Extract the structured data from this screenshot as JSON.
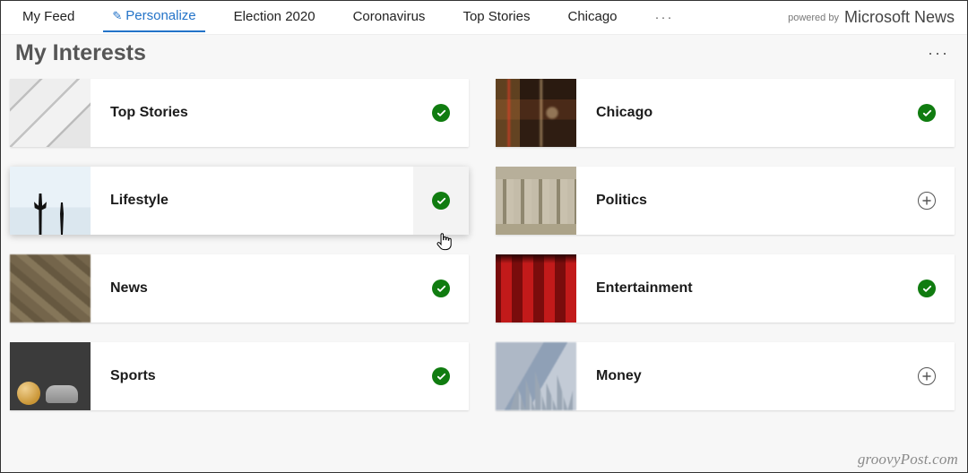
{
  "topnav": {
    "tabs": [
      {
        "label": "My Feed"
      },
      {
        "label": "Personalize",
        "active": true,
        "icon": "pencil"
      },
      {
        "label": "Election 2020"
      },
      {
        "label": "Coronavirus"
      },
      {
        "label": "Top Stories"
      },
      {
        "label": "Chicago"
      }
    ],
    "more": "···",
    "powered_by": "powered by",
    "brand": "Microsoft News"
  },
  "heading": {
    "title": "My Interests",
    "more": "···"
  },
  "cards": [
    {
      "title": "Top Stories",
      "selected": true,
      "thumb": "th-newspaper"
    },
    {
      "title": "Chicago",
      "selected": true,
      "thumb": "th-chicago"
    },
    {
      "title": "Lifestyle",
      "selected": true,
      "thumb": "th-lifestyle",
      "hover": true
    },
    {
      "title": "Politics",
      "selected": false,
      "thumb": "th-politics"
    },
    {
      "title": "News",
      "selected": true,
      "thumb": "th-news"
    },
    {
      "title": "Entertainment",
      "selected": true,
      "thumb": "th-entertainment"
    },
    {
      "title": "Sports",
      "selected": true,
      "thumb": "th-sports"
    },
    {
      "title": "Money",
      "selected": false,
      "thumb": "th-money"
    }
  ],
  "watermark": "groovyPost.com"
}
